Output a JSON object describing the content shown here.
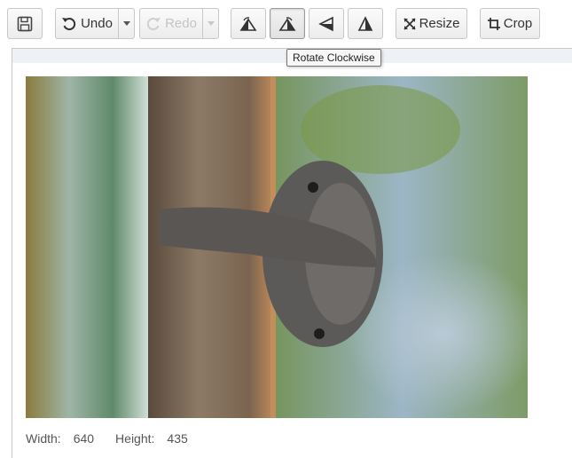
{
  "toolbar": {
    "save_icon": "floppy-disk-icon",
    "undo_label": "Undo",
    "undo_icon": "undo-arrow-icon",
    "redo_label": "Redo",
    "redo_icon": "redo-arrow-icon",
    "rotate_ccw_icon": "rotate-counterclockwise-icon",
    "rotate_cw_icon": "rotate-clockwise-icon",
    "flip_vertical_icon": "flip-vertical-icon",
    "flip_horizontal_icon": "flip-horizontal-icon",
    "resize_label": "Resize",
    "resize_icon": "resize-arrows-icon",
    "crop_label": "Crop",
    "crop_icon": "crop-icon"
  },
  "tooltip": {
    "text": "Rotate Clockwise"
  },
  "image_info": {
    "width_label": "Width:",
    "width_value": "640",
    "height_label": "Height:",
    "height_value": "435"
  },
  "colors": {
    "button_border": "#c8c8c8",
    "disabled_text": "#c4c4c4",
    "canvas_strip": "#eef1f5"
  }
}
